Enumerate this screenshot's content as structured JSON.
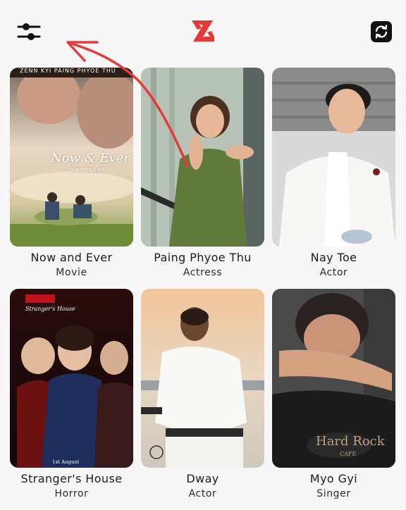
{
  "header": {
    "filter_icon": "sliders-icon",
    "logo_icon": "z-logo-icon",
    "refresh_icon": "refresh-icon",
    "accent": "#e53935"
  },
  "cards": [
    {
      "title": "Now and Ever",
      "subtitle": "Movie",
      "poster": {
        "top_names": "ZENN KYI  PAING PHYOE THU",
        "script": "Now & Ever",
        "credit": "CHRISTINA KYI"
      }
    },
    {
      "title": "Paing Phyoe Thu",
      "subtitle": "Actress"
    },
    {
      "title": "Nay Toe",
      "subtitle": "Actor"
    },
    {
      "title": "Stranger's House",
      "subtitle": "Horror",
      "poster": {
        "logo_en": "Stranger's House",
        "date": "1st August"
      }
    },
    {
      "title": "Dway",
      "subtitle": "Actor"
    },
    {
      "title": "Myo Gyi",
      "subtitle": "Singer",
      "poster": {
        "shirt_text": "Hard Rock",
        "shirt_sub": "CAFE"
      }
    }
  ]
}
